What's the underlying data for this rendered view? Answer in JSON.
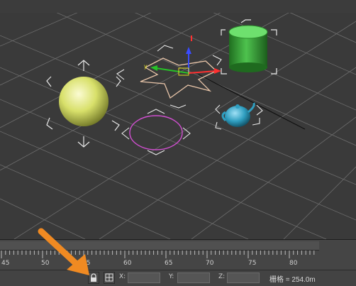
{
  "timeline": {
    "ticks": [
      "45",
      "50",
      "55",
      "60",
      "65",
      "70",
      "75",
      "80"
    ]
  },
  "statusbar": {
    "x_label": "X:",
    "y_label": "Y:",
    "z_label": "Z:",
    "x_value": "",
    "y_value": "",
    "z_value": "",
    "grid_readout": "栅格 = 254.0m"
  },
  "icons": {
    "lock": "lock-icon",
    "absolute_mode": "absolute-mode-icon"
  },
  "colors": {
    "viewport_bg": "#3a3a3a",
    "grid_line": "#6e6e6e",
    "sphere": "#d8e06a",
    "cylinder": "#3fae3f",
    "teapot": "#2f9ec0",
    "star_shape": "#e7c4a8",
    "circle_shape": "#d04fd0",
    "annotation_arrow": "#f08a22"
  }
}
